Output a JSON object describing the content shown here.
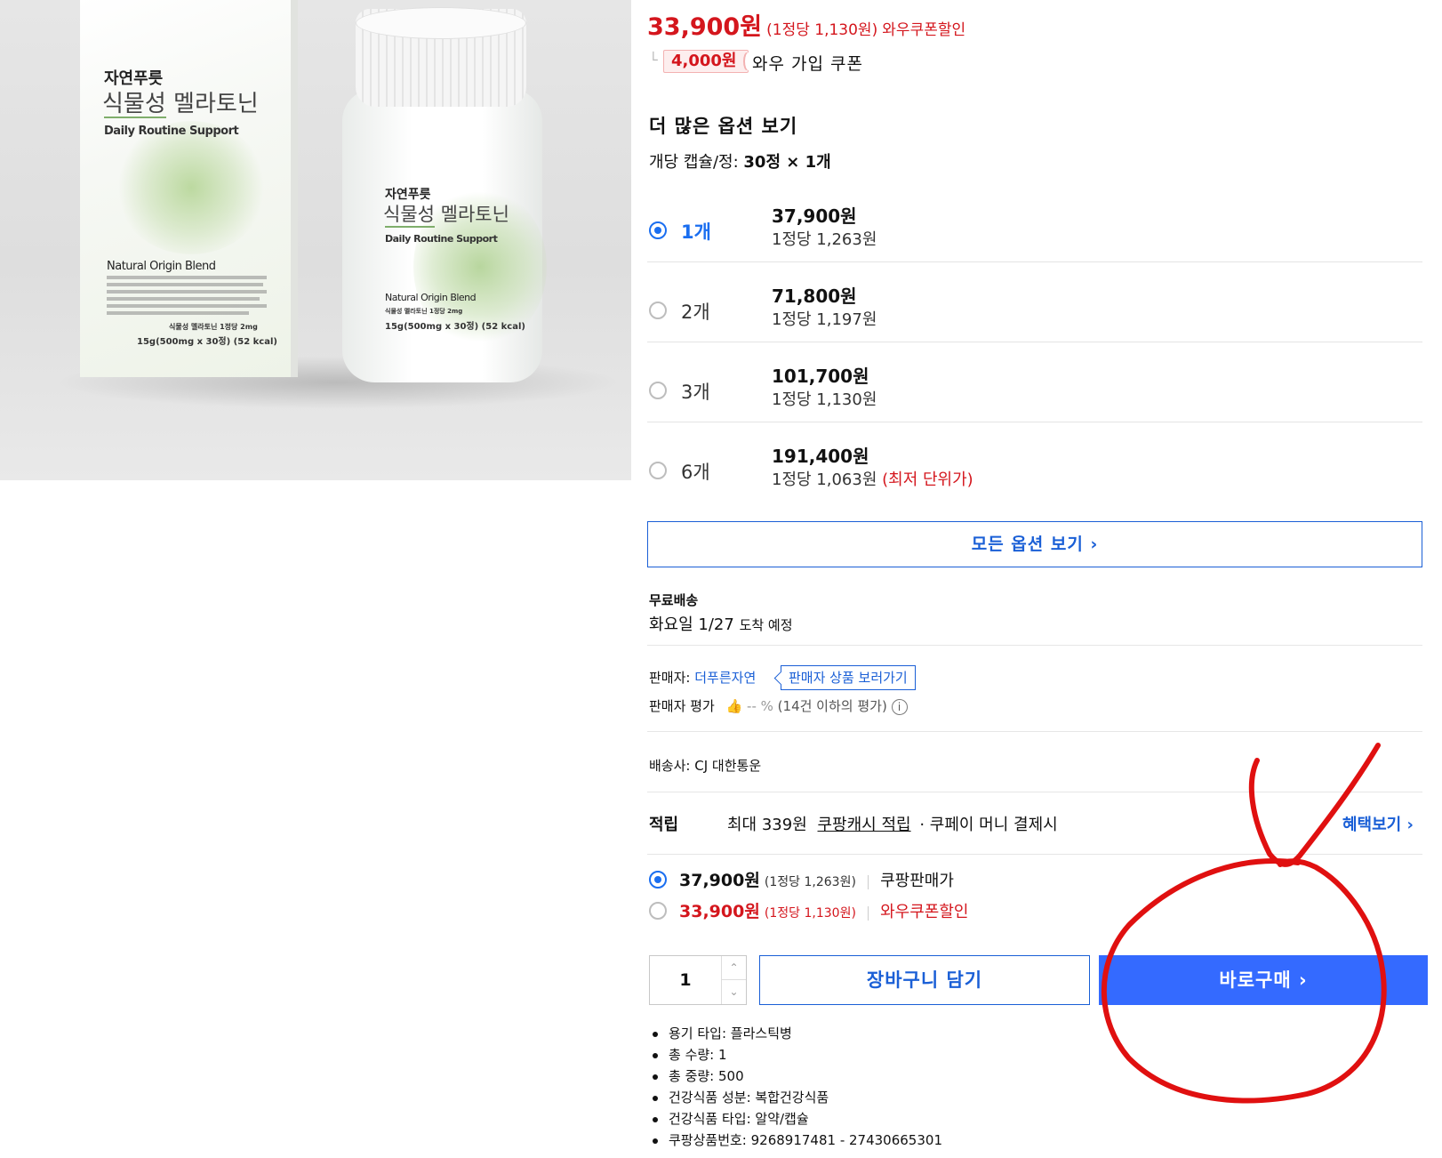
{
  "photo": {
    "box_brand": "자연푸릇",
    "box_product": "식물성 멜라토닌",
    "box_tagline": "Daily Routine Support",
    "box_blend": "Natural Origin Blend",
    "box_dose": "식물성 멜라토닌 1정당 2mg",
    "box_net": "15g(500mg x 30정) (52 kcal)",
    "bottle_brand": "자연푸릇",
    "bottle_product": "식물성 멜라토닌",
    "bottle_tagline": "Daily Routine Support",
    "bottle_blend": "Natural Origin Blend",
    "bottle_dose": "식물성 멜라토닌 1정당 2mg",
    "bottle_net": "15g(500mg x 30정) (52 kcal)"
  },
  "pricing": {
    "sale_price": "33,900원",
    "sale_unit": "(1정당 1,130원)",
    "sale_label": "와우쿠폰할인",
    "coupon_amount": "4,000원",
    "coupon_label": "와우 가입 쿠폰"
  },
  "options": {
    "title": "더 많은 옵션 보기",
    "spec_label": "개당 캡슐/정:",
    "spec_value": "30정 × 1개",
    "items": [
      {
        "qty": "1개",
        "price": "37,900원",
        "unit": "1정당 1,263원",
        "note": "",
        "selected": true
      },
      {
        "qty": "2개",
        "price": "71,800원",
        "unit": "1정당 1,197원",
        "note": "",
        "selected": false
      },
      {
        "qty": "3개",
        "price": "101,700원",
        "unit": "1정당 1,130원",
        "note": "",
        "selected": false
      },
      {
        "qty": "6개",
        "price": "191,400원",
        "unit": "1정당 1,063원",
        "note": "(최저 단위가)",
        "selected": false
      }
    ],
    "all_options_label": "모든 옵션 보기 ›"
  },
  "shipping": {
    "title": "무료배송",
    "arrival": "화요일 1/27",
    "arrival_suffix": "도착 예정"
  },
  "seller": {
    "label": "판매자:",
    "name": "더푸른자연",
    "products_button": "판매자 상품 보러가기",
    "rating_label": "판매자 평가",
    "rating_value": "-- %",
    "rating_note": "(14건 이하의 평가)"
  },
  "carrier": {
    "label": "배송사:",
    "name": "CJ 대한통운"
  },
  "reward": {
    "label": "적립",
    "text_prefix": "최대 339원",
    "text_link": "쿠팡캐시 적립",
    "text_suffix": "· 쿠페이 머니 결제시",
    "benefit_link": "혜택보기 ›"
  },
  "price_choice": [
    {
      "price": "37,900원",
      "unit": "(1정당 1,263원)",
      "label": "쿠팡판매가",
      "selected": true
    },
    {
      "price": "33,900원",
      "unit": "(1정당 1,130원)",
      "label": "와우쿠폰할인",
      "selected": false
    }
  ],
  "purchase": {
    "quantity": "1",
    "cart_label": "장바구니 담기",
    "buy_label": "바로구매 ›"
  },
  "specs": [
    "용기 타입: 플라스틱병",
    "총 수량: 1",
    "총 중량: 500",
    "건강식품 성분: 복합건강식품",
    "건강식품 타입: 알약/캡슐",
    "쿠팡상품번호: 9268917481 - 27430665301"
  ],
  "colors": {
    "accent_blue": "#346aff",
    "link_blue": "#1a5fd6",
    "sale_red": "#d4161d",
    "annotation_red": "#e01010"
  }
}
